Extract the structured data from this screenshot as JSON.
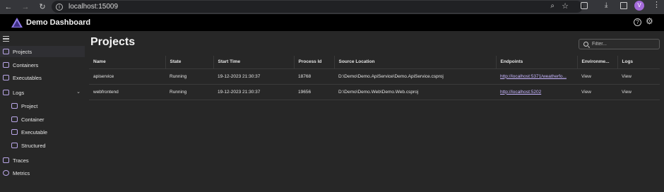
{
  "browser": {
    "url": "localhost:15009",
    "profile_initial": "V"
  },
  "app": {
    "title": "Demo Dashboard",
    "accent": "#b9a6e8"
  },
  "sidebar": {
    "items": [
      {
        "label": "Projects",
        "icon": "projects-icon"
      },
      {
        "label": "Containers",
        "icon": "containers-icon"
      },
      {
        "label": "Executables",
        "icon": "executables-icon"
      },
      {
        "label": "Logs",
        "icon": "logs-icon"
      },
      {
        "label": "Project",
        "icon": "project-log-icon"
      },
      {
        "label": "Container",
        "icon": "container-log-icon"
      },
      {
        "label": "Executable",
        "icon": "executable-log-icon"
      },
      {
        "label": "Structured",
        "icon": "structured-log-icon"
      },
      {
        "label": "Traces",
        "icon": "traces-icon"
      },
      {
        "label": "Metrics",
        "icon": "metrics-icon"
      }
    ]
  },
  "main": {
    "title": "Projects",
    "filter_placeholder": "Filter...",
    "columns": [
      "Name",
      "State",
      "Start Time",
      "Process Id",
      "Source Location",
      "Endpoints",
      "Environme...",
      "Logs"
    ],
    "rows": [
      {
        "name": "apiservice",
        "state": "Running",
        "start_time": "19-12-2023 21:30:37",
        "process_id": "18768",
        "source": "D:\\Demo\\Demo.ApiService\\Demo.ApiService.csproj",
        "endpoint": "http://localhost:5371/weatherfo...",
        "env": "View",
        "logs": "View"
      },
      {
        "name": "webfrontend",
        "state": "Running",
        "start_time": "19-12-2023 21:30:37",
        "process_id": "19656",
        "source": "D:\\Demo\\Demo.Web\\Demo.Web.csproj",
        "endpoint": "http://localhost:5202",
        "env": "View",
        "logs": "View"
      }
    ]
  }
}
